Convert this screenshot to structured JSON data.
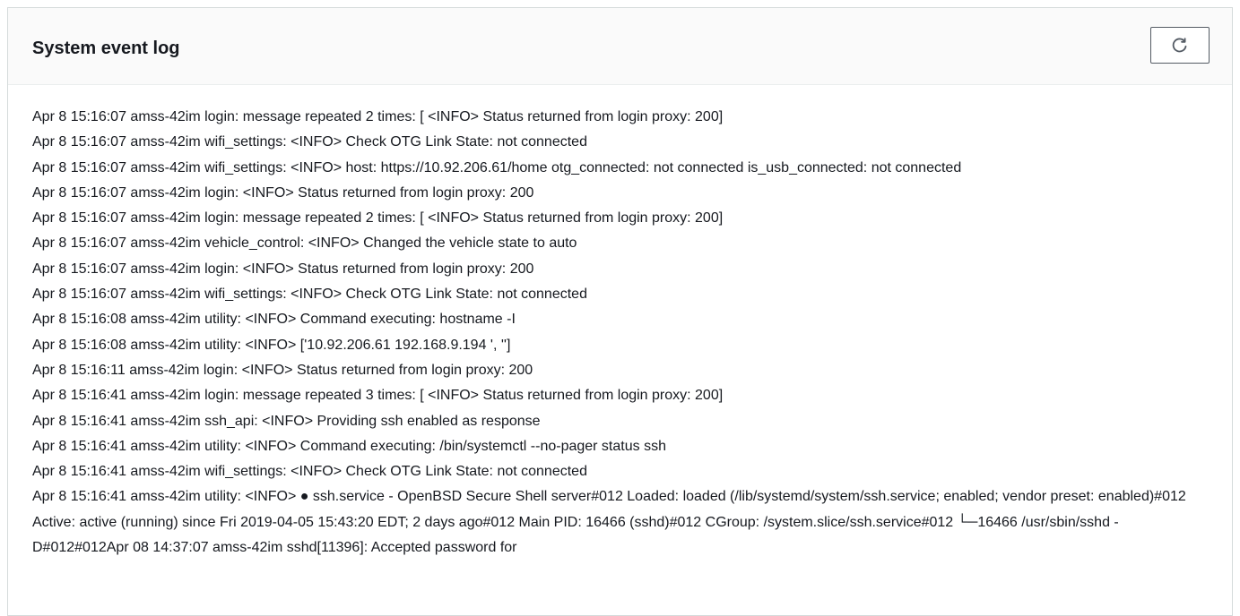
{
  "panel": {
    "title": "System event log",
    "refresh_icon": "refresh-icon"
  },
  "log": {
    "lines": [
      "Apr 8 15:16:07 amss-42im login: message repeated 2 times: [ <INFO> Status returned from login proxy: 200]",
      "Apr 8 15:16:07 amss-42im wifi_settings: <INFO> Check OTG Link State: not connected",
      "Apr 8 15:16:07 amss-42im wifi_settings: <INFO> host: https://10.92.206.61/home otg_connected: not connected is_usb_connected: not connected",
      "Apr 8 15:16:07 amss-42im login: <INFO> Status returned from login proxy: 200",
      "Apr 8 15:16:07 amss-42im login: message repeated 2 times: [ <INFO> Status returned from login proxy: 200]",
      "Apr 8 15:16:07 amss-42im vehicle_control: <INFO> Changed the vehicle state to auto",
      "Apr 8 15:16:07 amss-42im login: <INFO> Status returned from login proxy: 200",
      "Apr 8 15:16:07 amss-42im wifi_settings: <INFO> Check OTG Link State: not connected",
      "Apr 8 15:16:08 amss-42im utility: <INFO> Command executing: hostname -I",
      "Apr 8 15:16:08 amss-42im utility: <INFO> ['10.92.206.61 192.168.9.194 ', '']",
      "Apr 8 15:16:11 amss-42im login: <INFO> Status returned from login proxy: 200",
      "Apr 8 15:16:41 amss-42im login: message repeated 3 times: [ <INFO> Status returned from login proxy: 200]",
      "Apr 8 15:16:41 amss-42im ssh_api: <INFO> Providing ssh enabled as response",
      "Apr 8 15:16:41 amss-42im utility: <INFO> Command executing: /bin/systemctl --no-pager status ssh",
      "Apr 8 15:16:41 amss-42im wifi_settings: <INFO> Check OTG Link State: not connected",
      "Apr 8 15:16:41 amss-42im utility: <INFO> ● ssh.service - OpenBSD Secure Shell server#012 Loaded: loaded (/lib/systemd/system/ssh.service; enabled; vendor preset: enabled)#012 Active: active (running) since Fri 2019-04-05 15:43:20 EDT; 2 days ago#012 Main PID: 16466 (sshd)#012 CGroup: /system.slice/ssh.service#012 └─16466 /usr/sbin/sshd -D#012#012Apr 08 14:37:07 amss-42im sshd[11396]: Accepted password for"
    ]
  }
}
